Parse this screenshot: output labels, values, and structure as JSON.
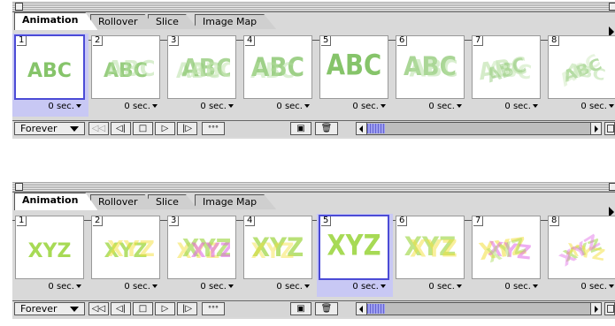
{
  "palettes": [
    {
      "tabs": [
        "Animation",
        "Rollover",
        "Slice",
        "Image Map"
      ],
      "active_tab": 0,
      "selected_frame": 0,
      "art_text": "ABC",
      "colors": [
        "#86c46a",
        "#b2dd9d",
        "#c9e7b8"
      ],
      "frames": [
        {
          "number": "1",
          "delay": "0 sec."
        },
        {
          "number": "2",
          "delay": "0 sec."
        },
        {
          "number": "3",
          "delay": "0 sec."
        },
        {
          "number": "4",
          "delay": "0 sec."
        },
        {
          "number": "5",
          "delay": "0 sec."
        },
        {
          "number": "6",
          "delay": "0 sec."
        },
        {
          "number": "7",
          "delay": "0 sec."
        },
        {
          "number": "8",
          "delay": "0 sec."
        }
      ],
      "loop": "Forever"
    },
    {
      "tabs": [
        "Animation",
        "Rollover",
        "Slice",
        "Image Map"
      ],
      "active_tab": 0,
      "selected_frame": 4,
      "art_text": "XYZ",
      "colors": [
        "#a7da55",
        "#f3df3a",
        "#e06ae6"
      ],
      "frames": [
        {
          "number": "1",
          "delay": "0 sec."
        },
        {
          "number": "2",
          "delay": "0 sec."
        },
        {
          "number": "3",
          "delay": "0 sec."
        },
        {
          "number": "4",
          "delay": "0 sec."
        },
        {
          "number": "5",
          "delay": "0 sec."
        },
        {
          "number": "6",
          "delay": "0 sec."
        },
        {
          "number": "7",
          "delay": "0 sec."
        },
        {
          "number": "8",
          "delay": "0 sec."
        }
      ],
      "loop": "Forever"
    }
  ]
}
